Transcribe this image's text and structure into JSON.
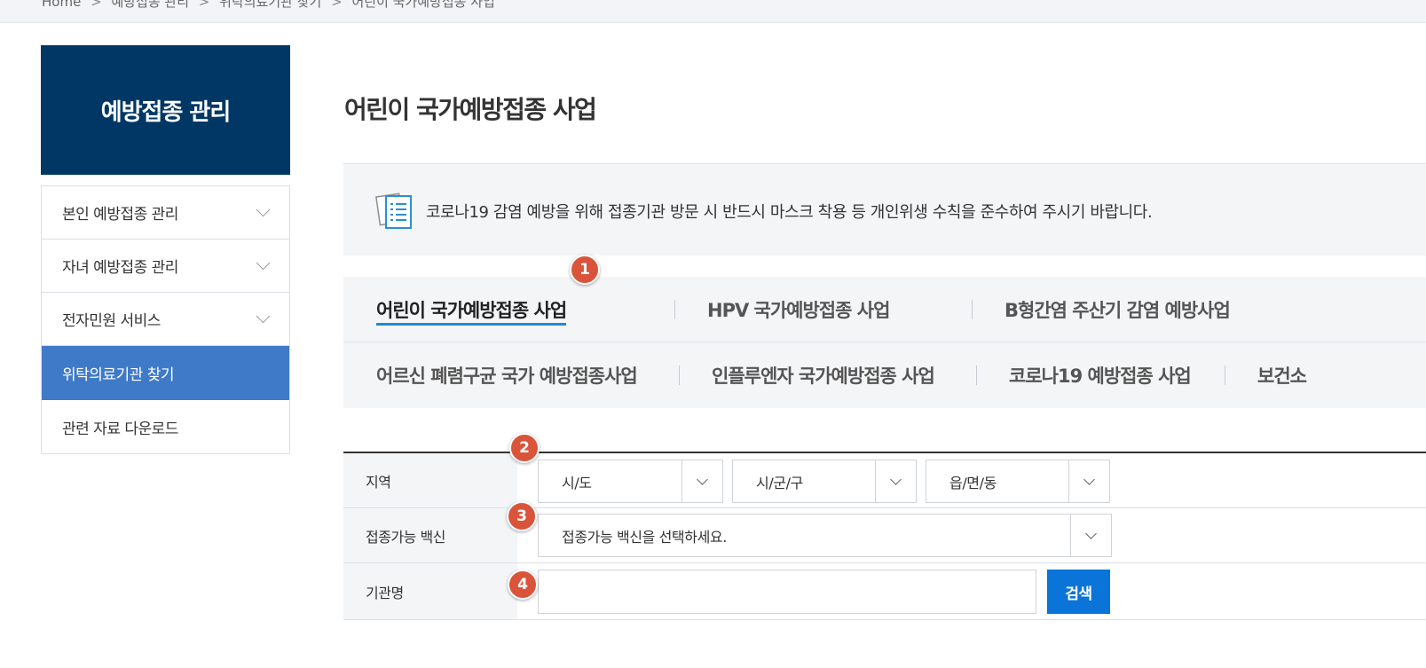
{
  "breadcrumb": [
    "Home",
    "예방접종 관리",
    "위탁의료기관 찾기",
    "어린이 국가예방접종 사업"
  ],
  "breadcrumb_separator": ">",
  "sidebar": {
    "title": "예방접종 관리",
    "items": [
      {
        "label": "본인 예방접종 관리",
        "expandable": true
      },
      {
        "label": "자녀 예방접종 관리",
        "expandable": true
      },
      {
        "label": "전자민원 서비스",
        "expandable": true
      },
      {
        "label": "위탁의료기관 찾기",
        "active": true
      },
      {
        "label": "관련 자료 다운로드"
      }
    ]
  },
  "page_title": "어린이 국가예방접종 사업",
  "notice": {
    "icon": "document-list-icon",
    "text": "코로나19 감염 예방을 위해 접종기관 방문 시 반드시 마스크 착용 등 개인위생 수칙을 준수하여 주시기 바랍니다."
  },
  "tabs": [
    {
      "label": "어린이 국가예방접종 사업",
      "active": true
    },
    {
      "label": "HPV 국가예방접종 사업"
    },
    {
      "label": "B형간염 주산기 감염 예방사업"
    },
    {
      "label": "어르신 폐렴구균 국가 예방접종사업"
    },
    {
      "label": "인플루엔자 국가예방접종 사업"
    },
    {
      "label": "코로나19 예방접종 사업"
    },
    {
      "label": "보건소"
    }
  ],
  "badges": [
    "1",
    "2",
    "3",
    "4"
  ],
  "form": {
    "region_label": "지역",
    "region_selects": [
      "시/도",
      "시/군/구",
      "읍/면/동"
    ],
    "vaccine_label": "접종가능 백신",
    "vaccine_select": "접종가능 백신을 선택하세요.",
    "name_label": "기관명",
    "name_value": "",
    "search_button": "검색"
  },
  "colors": {
    "sidebar_head": "#003764",
    "sidebar_active": "#3f7ac8",
    "badge": "#d9543a",
    "search_button": "#0a74d8",
    "tab_underline": "#1e8bd4"
  }
}
